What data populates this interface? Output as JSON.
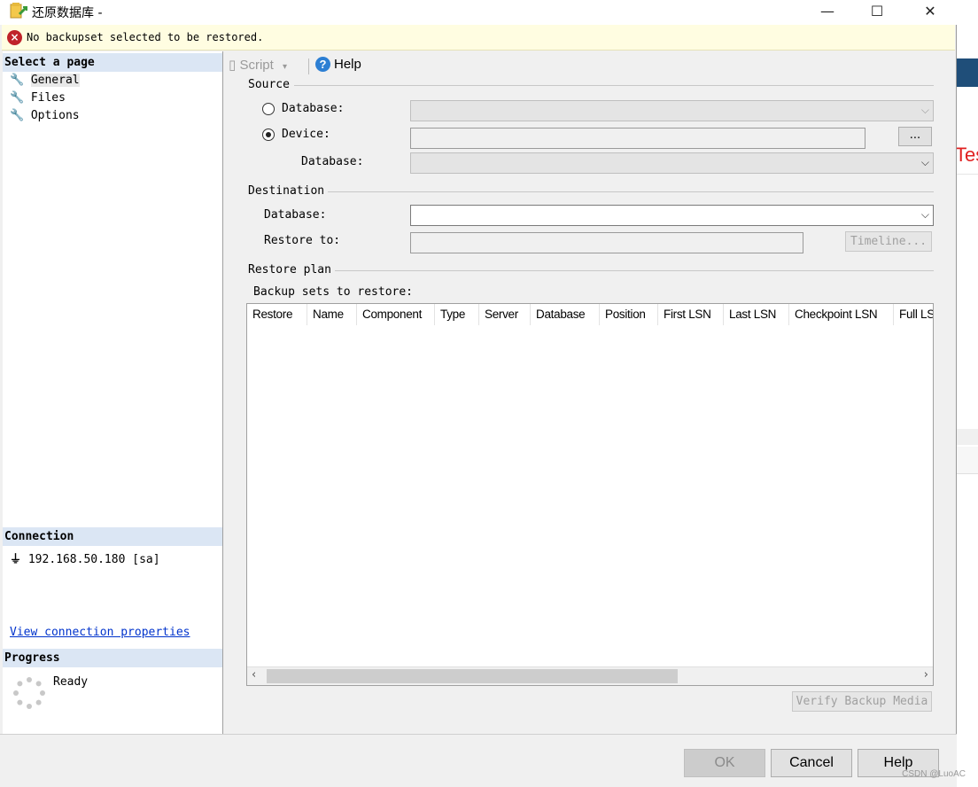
{
  "window": {
    "title": "还原数据库 -",
    "minimize": "—",
    "maximize": "☐",
    "close": "✕"
  },
  "error": {
    "icon": "error-icon",
    "message": "No backupset selected to be restored."
  },
  "left": {
    "select_page_header": "Select a page",
    "pages": [
      "General",
      "Files",
      "Options"
    ],
    "selected_page": "General",
    "connection_header": "Connection",
    "connection_value": "192.168.50.180 [sa]",
    "view_connection_link": "View connection properties",
    "progress_header": "Progress",
    "progress_status": "Ready"
  },
  "toolbar": {
    "script_label": "Script",
    "help_label": "Help"
  },
  "source": {
    "header": "Source",
    "database_radio": "Database:",
    "device_radio": "Device:",
    "selected": "device",
    "browse_button": "...",
    "device_database_label": "Database:"
  },
  "destination": {
    "header": "Destination",
    "database_label": "Database:",
    "restore_to_label": "Restore to:",
    "timeline_button": "Timeline..."
  },
  "restore_plan": {
    "header": "Restore plan",
    "backup_sets_label": "Backup sets to restore:",
    "columns": [
      "Restore",
      "Name",
      "Component",
      "Type",
      "Server",
      "Database",
      "Position",
      "First LSN",
      "Last LSN",
      "Checkpoint LSN",
      "Full LS"
    ],
    "verify_button": "Verify Backup Media"
  },
  "buttons": {
    "ok": "OK",
    "cancel": "Cancel",
    "help": "Help"
  },
  "background": {
    "partial_text": "Tes"
  },
  "watermark": "CSDN @LuoAC",
  "colors": {
    "section_header": "#dbe6f4",
    "error_bar": "#fffde1",
    "error_icon": "#c0222a",
    "link": "#0033cc",
    "help_icon": "#2d7fd3"
  }
}
